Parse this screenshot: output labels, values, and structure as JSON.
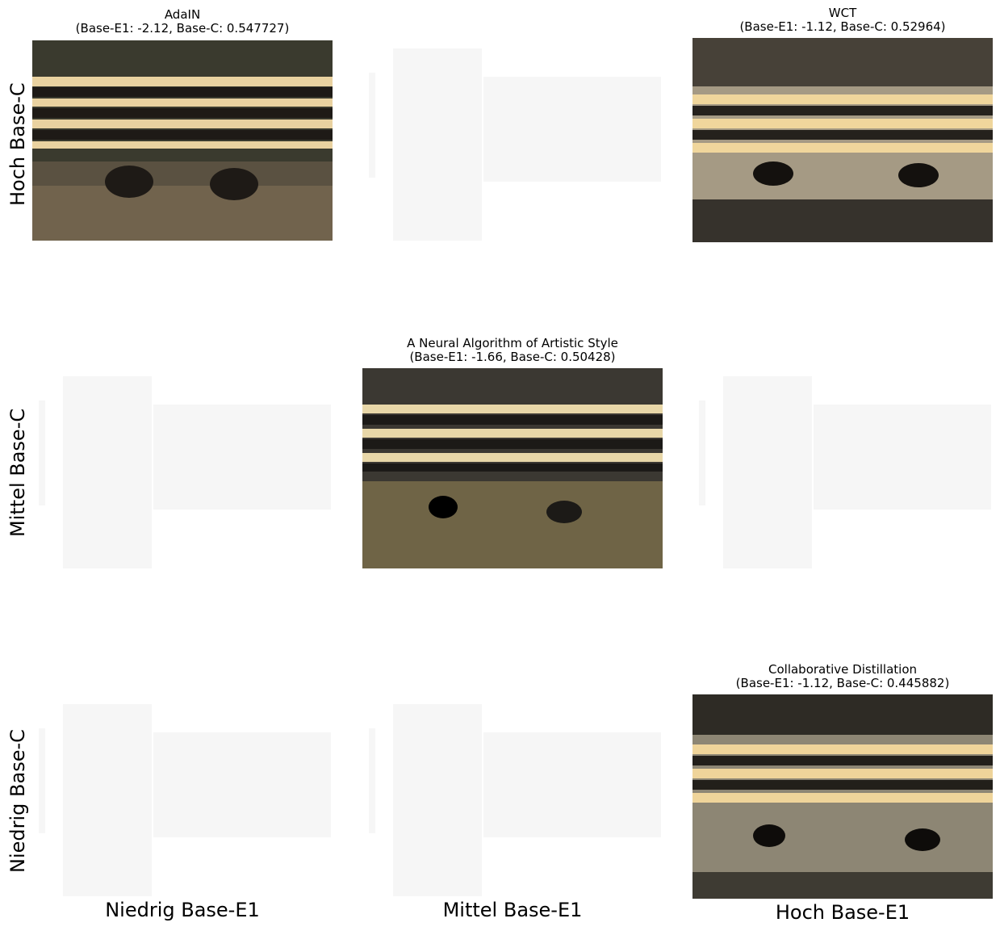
{
  "cells": {
    "adain": {
      "title": "AdaIN\n(Base-E1: -2.12, Base-C: 0.547727)",
      "image": "zebra-styled-image"
    },
    "wct": {
      "title": "WCT\n(Base-E1: -1.12, Base-C: 0.52964)",
      "image": "zebra-styled-image"
    },
    "gatys": {
      "title": "A Neural Algorithm of Artistic Style\n(Base-E1: -1.66, Base-C: 0.50428)",
      "image": "zebra-styled-image"
    },
    "cd": {
      "title": "Collaborative Distillation\n(Base-E1: -1.12, Base-C: 0.445882)",
      "image": "zebra-styled-image"
    }
  },
  "row_labels": {
    "top": "Hoch Base-C",
    "middle": "Mittel Base-C",
    "bottom": "Niedrig Base-C"
  },
  "col_labels": {
    "left": "Niedrig Base-E1",
    "middle": "Mittel Base-E1",
    "right": "Hoch Base-E1"
  }
}
